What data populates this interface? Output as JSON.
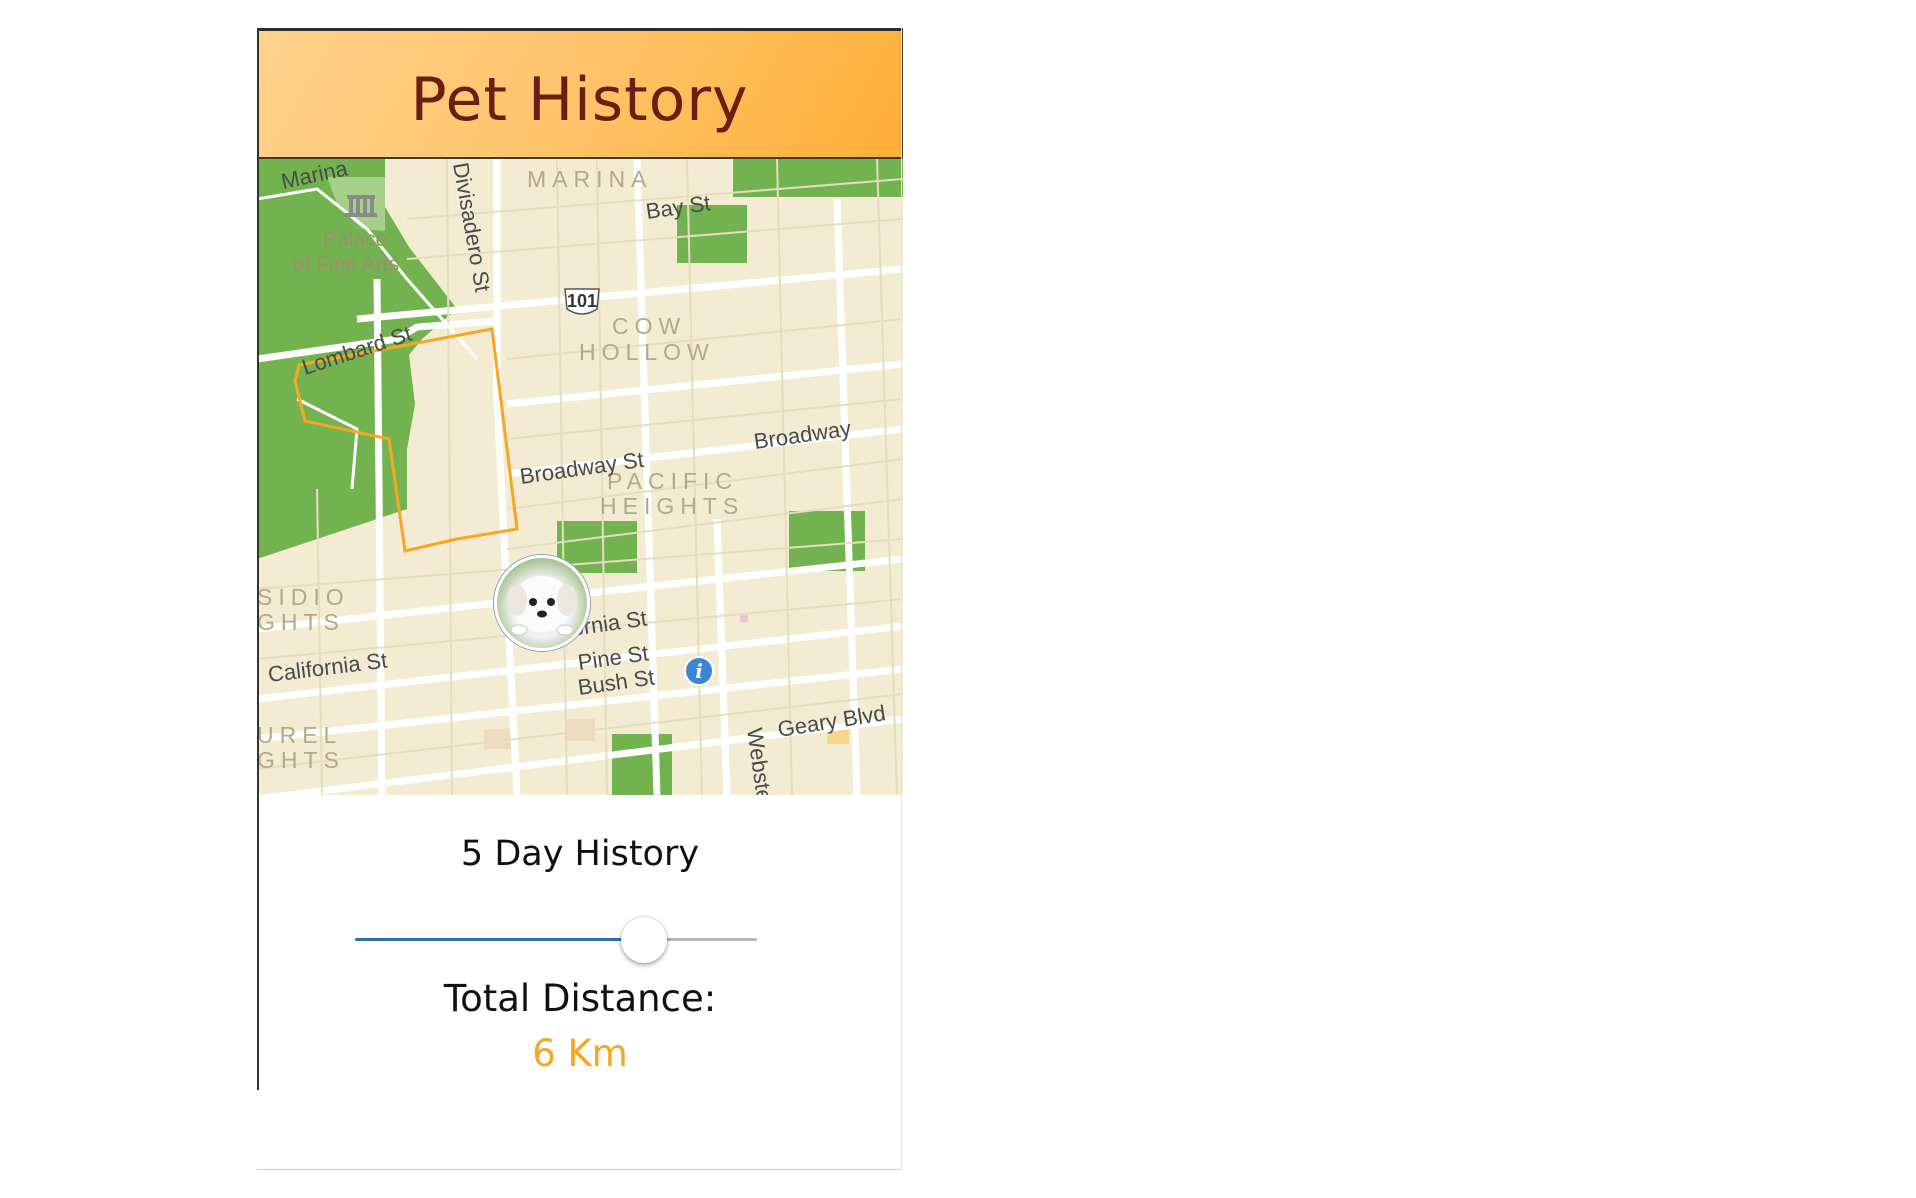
{
  "header": {
    "title": "Pet History"
  },
  "map": {
    "street_labels": {
      "marina": "Marina",
      "divisadero": "Divisadero St",
      "bay": "Bay St",
      "lombard": "Lombard St",
      "broadway_st": "Broadway St",
      "broadway": "Broadway",
      "california_st_right": "California St",
      "california_st_left": "California St",
      "pine": "Pine St",
      "bush": "Bush St",
      "geary": "Geary Blvd",
      "webster": "Webster St"
    },
    "district_labels": {
      "marina": "MARINA",
      "cow": "COW",
      "hollow": "HOLLOW",
      "pacific": "PACIFIC",
      "heights": "HEIGHTS",
      "presidio_1": "SIDIO",
      "presidio_2": "GHTS",
      "laurel_1": "UREL",
      "laurel_2": "GHTS"
    },
    "poi": {
      "palace_1": "Palace",
      "palace_2": "of Fine Arts"
    },
    "highway_shield": "101",
    "route_color": "#f5a623",
    "pet_marker_icon": "puppy-avatar",
    "info_icon": "info-icon",
    "info_glyph": "i"
  },
  "history": {
    "label": "5 Day History",
    "slider_level_percent": 72,
    "slider_fill_color": "#2f6fb8"
  },
  "distance": {
    "label": "Total Distance:",
    "value": "6 Km",
    "value_color": "#f5a623"
  }
}
